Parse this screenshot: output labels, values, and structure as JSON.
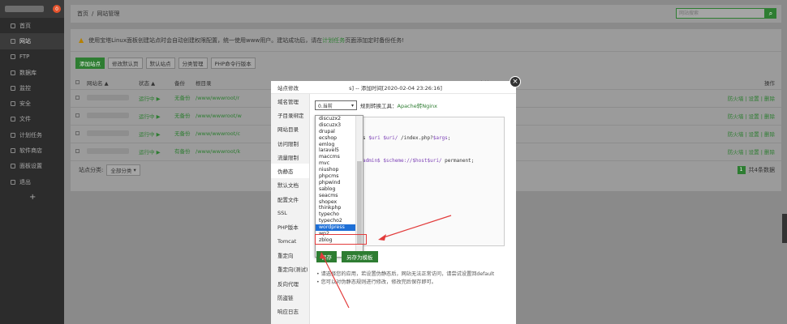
{
  "sidebar": {
    "badge": "0",
    "items": [
      {
        "label": "首页"
      },
      {
        "label": "网站"
      },
      {
        "label": "FTP"
      },
      {
        "label": "数据库"
      },
      {
        "label": "监控"
      },
      {
        "label": "安全"
      },
      {
        "label": "文件"
      },
      {
        "label": "计划任务"
      },
      {
        "label": "软件商店"
      },
      {
        "label": "面板设置"
      },
      {
        "label": "退出"
      }
    ],
    "add_label": "+"
  },
  "topbar": {
    "home": "首页",
    "separator": "/",
    "current": "网站管理",
    "search_placeholder": "网站搜索",
    "search_icon": "search-icon"
  },
  "notice": {
    "text": "使用宝塔Linux面板创建站点时会自动创建权限配置，统一使用www用户。建站成功后，请在",
    "link": "计划任务",
    "text_after": "页面添加定时备份任务!"
  },
  "toolbar": {
    "buttons": [
      "添加站点",
      "修改默认页",
      "默认站点",
      "分类管理",
      "PHP命令行版本"
    ]
  },
  "table": {
    "headers": {
      "name": "网站名 ▲",
      "status": "状态 ▲",
      "backup": "备份",
      "root": "根目录",
      "expire": "到期时间",
      "remark": "备注",
      "ops": "操作"
    },
    "rows": [
      {
        "status": "运行中 ▶",
        "backup": "无备份",
        "root": "/www/wwwroot/r",
        "ops": "防火墙 | 设置 | 删除"
      },
      {
        "status": "运行中 ▶",
        "backup": "无备份",
        "root": "/www/wwwroot/w",
        "ops": "防火墙 | 设置 | 删除"
      },
      {
        "status": "运行中 ▶",
        "backup": "无备份",
        "root": "/www/wwwroot/c",
        "ops": "防火墙 | 设置 | 删除"
      },
      {
        "status": "运行中 ▶",
        "backup": "有备份",
        "root": "/www/wwwroot/k",
        "ops": "防火墙 | 设置 | 删除"
      }
    ],
    "category_label": "站点分类:",
    "category_value": "全部分类",
    "page": "1",
    "total": "共4条数据"
  },
  "modal": {
    "title_prefix": "站点修改",
    "title_suffix": "s] -- 添加时间[2020-02-04 23:26:16]",
    "nav": [
      "域名管理",
      "子目录绑定",
      "网站目录",
      "访问限制",
      "流量限制",
      "伪静态",
      "默认文档",
      "配置文件",
      "SSL",
      "PHP版本",
      "Tomcat",
      "重定向",
      "重定向(测试)",
      "反向代理",
      "防盗链",
      "响应日志"
    ],
    "select_value": "0.当前",
    "rule_label": "规则转换工具：",
    "rule_link": "Apache转Nginx",
    "code_line1_a": "s ",
    "code_line1_var": "$uri $uri/",
    "code_line1_b": " /index.php?",
    "code_line1_var2": "$args",
    "code_line1_end": ";",
    "code_line2_a": "admin$ ",
    "code_line2_var": "$scheme://$host$uri/",
    "code_line2_b": " permanent;",
    "dropdown_options": [
      "discuzx2",
      "discuzx3",
      "drupal",
      "ecshop",
      "emlog",
      "laravel5",
      "maccms",
      "mvc",
      "niushop",
      "phpcms",
      "phpwind",
      "sablog",
      "seacms",
      "shopex",
      "thinkphp",
      "typecho",
      "typecho2",
      "wordpress",
      "wp2",
      "zblog"
    ],
    "selected_option": "wordpress",
    "save_button": "保存",
    "save_template_button": "另存为模板",
    "tip1": "请选择您的应用，若设置伪静态后，网站无法正常访问，请尝试设置回default",
    "tip2": "您可以对伪静态规则进行修改，修改完后保存即可。"
  },
  "colors": {
    "accent": "#2e7d32",
    "highlight": "#e23b3b",
    "selection": "#1e6fd6"
  }
}
